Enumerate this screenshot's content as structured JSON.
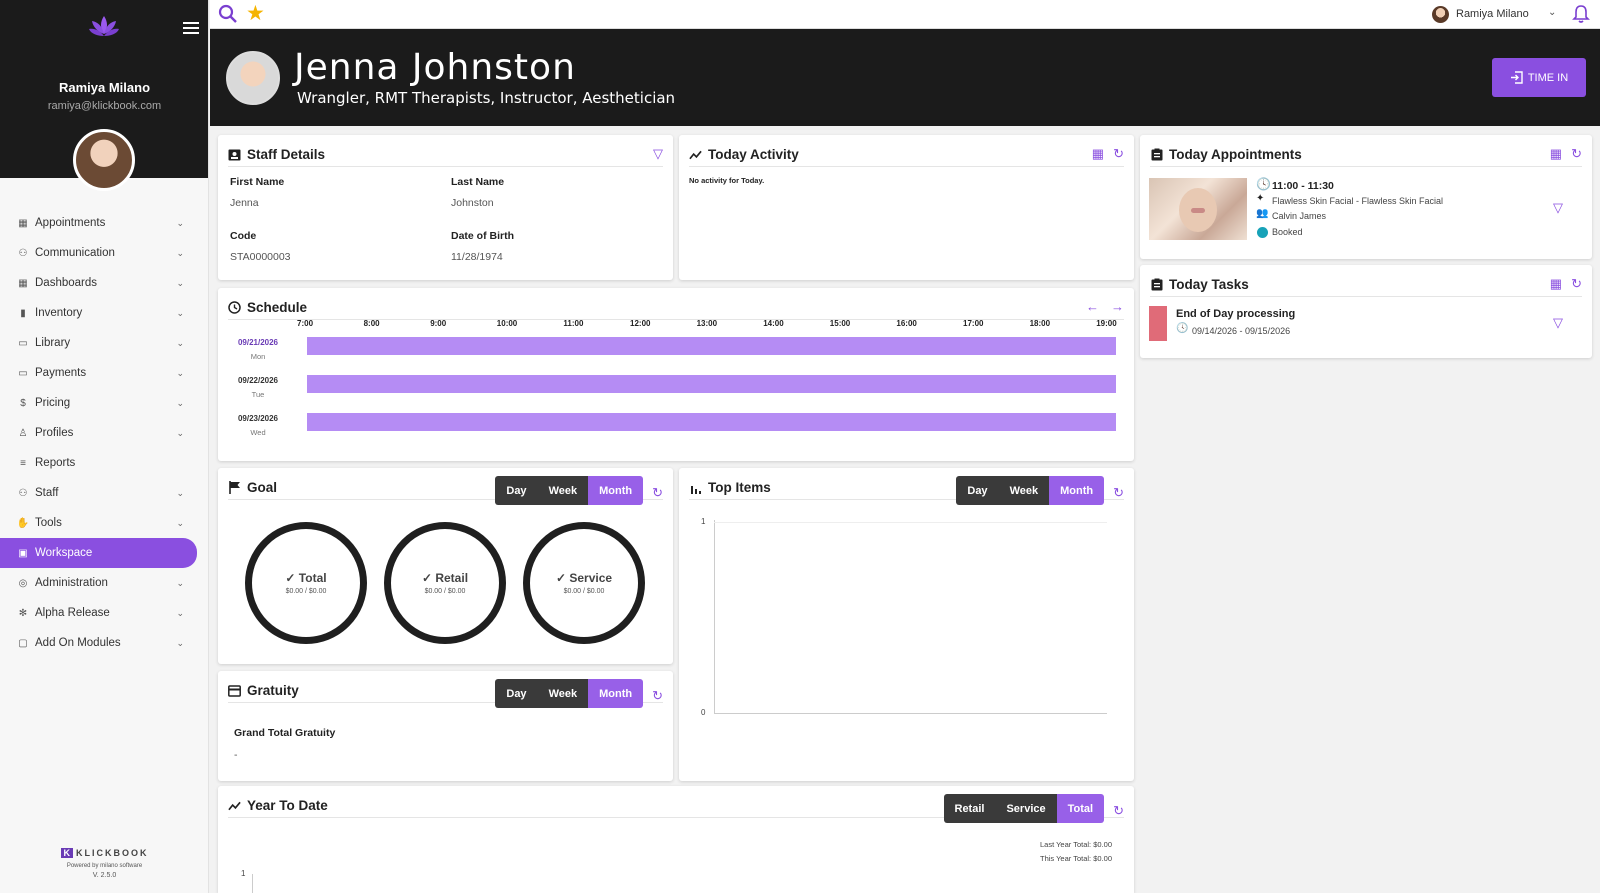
{
  "sidebar": {
    "user_name": "Ramiya Milano",
    "user_email": "ramiya@klickbook.com",
    "items": [
      {
        "label": "Appointments",
        "icon": "calendar-icon",
        "chevron": true
      },
      {
        "label": "Communication",
        "icon": "people-icon",
        "chevron": true
      },
      {
        "label": "Dashboards",
        "icon": "grid-icon",
        "chevron": true
      },
      {
        "label": "Inventory",
        "icon": "box-icon",
        "chevron": true
      },
      {
        "label": "Library",
        "icon": "book-icon",
        "chevron": true
      },
      {
        "label": "Payments",
        "icon": "card-icon",
        "chevron": true
      },
      {
        "label": "Pricing",
        "icon": "dollar-icon",
        "chevron": true
      },
      {
        "label": "Profiles",
        "icon": "person-icon",
        "chevron": true
      },
      {
        "label": "Reports",
        "icon": "lines-icon",
        "chevron": false
      },
      {
        "label": "Staff",
        "icon": "group-icon",
        "chevron": true
      },
      {
        "label": "Tools",
        "icon": "hand-icon",
        "chevron": true
      },
      {
        "label": "Workspace",
        "icon": "workspace-icon",
        "chevron": false,
        "active": true
      },
      {
        "label": "Administration",
        "icon": "target-icon",
        "chevron": true
      },
      {
        "label": "Alpha Release",
        "icon": "gear-icon",
        "chevron": true
      },
      {
        "label": "Add On Modules",
        "icon": "folder-icon",
        "chevron": true
      }
    ],
    "brand": "KLICKBOOK",
    "brand_k": "K",
    "brand_powered": "Powered by milano software",
    "version": "V. 2.5.0"
  },
  "topbar": {
    "user_name": "Ramiya Milano"
  },
  "header": {
    "name": "Jenna Johnston",
    "roles": "Wrangler, RMT Therapists, Instructor, Aesthetician",
    "time_in_label": "TIME IN"
  },
  "staff_details": {
    "title": "Staff Details",
    "first_name_label": "First Name",
    "first_name": "Jenna",
    "last_name_label": "Last Name",
    "last_name": "Johnston",
    "code_label": "Code",
    "code": "STA0000003",
    "dob_label": "Date of Birth",
    "dob": "11/28/1974"
  },
  "today_activity": {
    "title": "Today Activity",
    "empty": "No activity for Today."
  },
  "today_appointments": {
    "title": "Today Appointments",
    "time": "11:00 - 11:30",
    "service": "Flawless Skin Facial - Flawless Skin Facial",
    "client": "Calvin James",
    "status": "Booked",
    "status_color": "#17a2b8"
  },
  "today_tasks": {
    "title": "Today Tasks",
    "task": "End of Day processing",
    "dates": "09/14/2026 - 09/15/2026",
    "task_color": "#e06b78"
  },
  "schedule": {
    "title": "Schedule",
    "times": [
      "7:00",
      "8:00",
      "9:00",
      "10:00",
      "11:00",
      "12:00",
      "13:00",
      "14:00",
      "15:00",
      "16:00",
      "17:00",
      "18:00",
      "19:00"
    ],
    "days": [
      {
        "date": "09/21/2026",
        "dow": "Mon"
      },
      {
        "date": "09/22/2026",
        "dow": "Tue"
      },
      {
        "date": "09/23/2026",
        "dow": "Wed"
      }
    ]
  },
  "goal": {
    "title": "Goal",
    "seg": [
      "Day",
      "Week",
      "Month"
    ],
    "rings": [
      {
        "name": "Total",
        "value": "$0.00 / $0.00"
      },
      {
        "name": "Retail",
        "value": "$0.00 / $0.00"
      },
      {
        "name": "Service",
        "value": "$0.00 / $0.00"
      }
    ]
  },
  "top_items": {
    "title": "Top Items",
    "seg": [
      "Day",
      "Week",
      "Month"
    ],
    "y_max": "1",
    "y_min": "0"
  },
  "gratuity": {
    "title": "Gratuity",
    "seg": [
      "Day",
      "Week",
      "Month"
    ],
    "label": "Grand Total Gratuity",
    "value": "-"
  },
  "ytd": {
    "title": "Year To Date",
    "seg": [
      "Retail",
      "Service",
      "Total"
    ],
    "last_year": "Last Year Total: $0.00",
    "this_year": "This Year Total: $0.00",
    "y_tick": "1"
  },
  "colors": {
    "accent": "#8a4fe0",
    "dark": "#1b1b1b",
    "schedule_bar": "#b58cf4"
  }
}
